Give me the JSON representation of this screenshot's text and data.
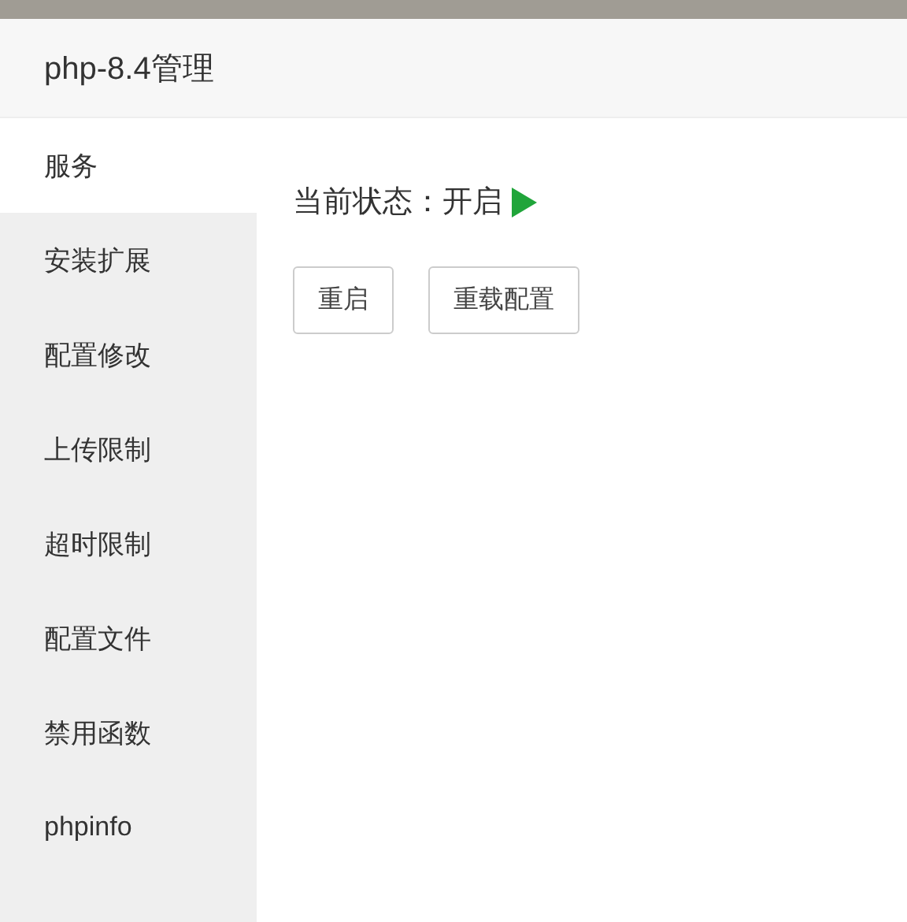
{
  "window": {
    "title": "php-8.4管理"
  },
  "sidebar": {
    "items": [
      {
        "label": "服务",
        "selected": true
      },
      {
        "label": "安装扩展",
        "selected": false
      },
      {
        "label": "配置修改",
        "selected": false
      },
      {
        "label": "上传限制",
        "selected": false
      },
      {
        "label": "超时限制",
        "selected": false
      },
      {
        "label": "配置文件",
        "selected": false
      },
      {
        "label": "禁用函数",
        "selected": false
      },
      {
        "label": "phpinfo",
        "selected": false
      }
    ]
  },
  "status": {
    "label": "当前状态：开启",
    "running": true
  },
  "buttons": [
    "重启",
    "重载配置"
  ]
}
